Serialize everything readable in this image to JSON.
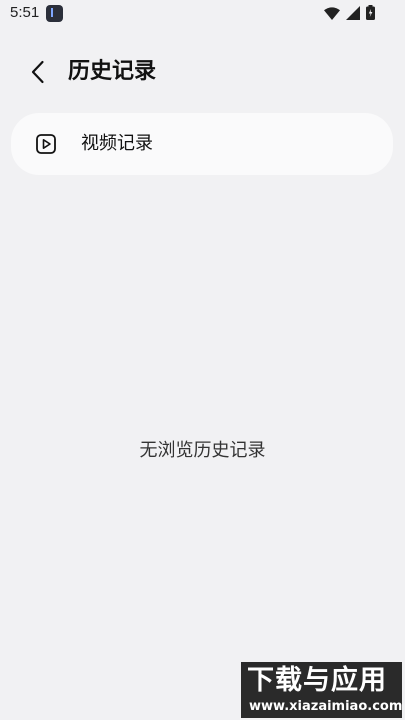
{
  "status_bar": {
    "time": "5:51",
    "icons": [
      "app-icon",
      "wifi-icon",
      "signal-icon",
      "battery-icon"
    ]
  },
  "header": {
    "title": "历史记录",
    "back_icon": "chevron-left-icon"
  },
  "records": [
    {
      "label": "视频记录",
      "icon": "play-box-icon"
    }
  ],
  "empty_state": {
    "text": "无浏览历史记录"
  },
  "watermark": {
    "title": "下载与应用",
    "url": "www.xiazaimiao.com"
  }
}
